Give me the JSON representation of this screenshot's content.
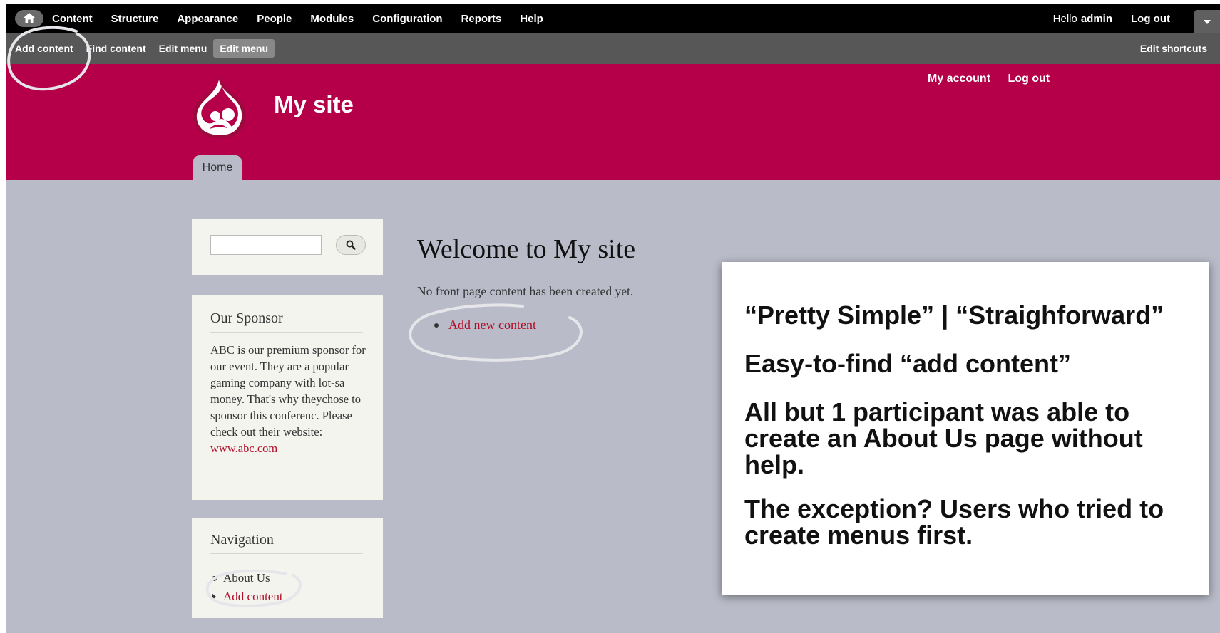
{
  "toolbar": {
    "menu": [
      "Content",
      "Structure",
      "Appearance",
      "People",
      "Modules",
      "Configuration",
      "Reports",
      "Help"
    ],
    "hello": "Hello",
    "username": "admin",
    "logout": "Log out"
  },
  "shortcuts": {
    "items": [
      "Add content",
      "Find content",
      "Edit menu",
      "Edit menu"
    ],
    "edit_shortcuts": "Edit shortcuts"
  },
  "header": {
    "site_name": "My site",
    "secondary_menu": [
      "My account",
      "Log out"
    ],
    "tab_home": "Home"
  },
  "sidebar": {
    "sponsor": {
      "title": "Our Sponsor",
      "body": "ABC is our premium sponsor for our event. They are a popular gaming company with lot-sa money. That's why theychose to sponsor this conferenc. Please check out their website:",
      "link": "www.abc.com"
    },
    "navigation": {
      "title": "Navigation",
      "items": [
        "About Us",
        "Add content"
      ]
    }
  },
  "main": {
    "title": "Welcome to My site",
    "message": "No front page content has been created yet.",
    "link": "Add new content"
  },
  "callout": {
    "lines": [
      "“Pretty Simple” | “Straighforward”",
      "Easy-to-find “add content”",
      "All but 1 participant was able to create an About Us page without help.",
      "The exception? Users who tried to create menus first."
    ]
  },
  "colors": {
    "header": "#b50049",
    "toolbar": "#000000",
    "shortcuts_bar": "#575757",
    "link": "#b10f29",
    "background": "#b9bcc8"
  }
}
